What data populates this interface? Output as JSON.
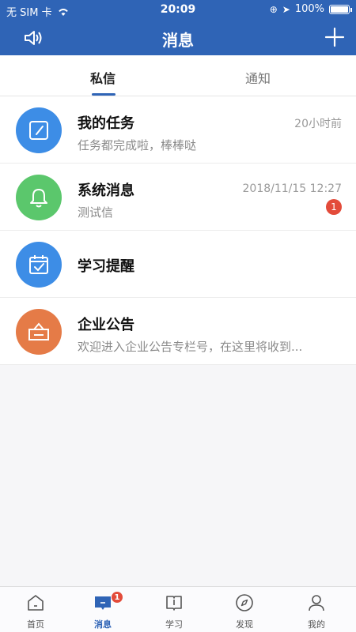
{
  "status_bar": {
    "carrier": "无 SIM 卡",
    "time": "20:09",
    "battery": "100%"
  },
  "header": {
    "title": "消息"
  },
  "tabs": [
    {
      "label": "私信"
    },
    {
      "label": "通知"
    }
  ],
  "messages": [
    {
      "title": "我的任务",
      "subtitle": "任务都完成啦，棒棒哒",
      "time": "20小时前",
      "badge": "",
      "color": "#3d8de6",
      "icon": "edit-icon"
    },
    {
      "title": "系统消息",
      "subtitle": "测试信",
      "time": "2018/11/15 12:27",
      "badge": "1",
      "color": "#5bc76c",
      "icon": "bell-icon"
    },
    {
      "title": "学习提醒",
      "subtitle": "",
      "time": "",
      "badge": "",
      "color": "#3d8de6",
      "icon": "calendar-check-icon"
    },
    {
      "title": "企业公告",
      "subtitle": "欢迎进入企业公告专栏号，在这里将收到...",
      "time": "",
      "badge": "",
      "color": "#e57b47",
      "icon": "announcement-icon"
    }
  ],
  "tabbar": [
    {
      "label": "首页",
      "icon": "home-icon"
    },
    {
      "label": "消息",
      "icon": "message-icon",
      "badge": "1"
    },
    {
      "label": "学习",
      "icon": "book-icon"
    },
    {
      "label": "发现",
      "icon": "compass-icon"
    },
    {
      "label": "我的",
      "icon": "user-icon"
    }
  ],
  "colors": {
    "primary": "#2f64b6",
    "badge": "#e34b3a"
  }
}
